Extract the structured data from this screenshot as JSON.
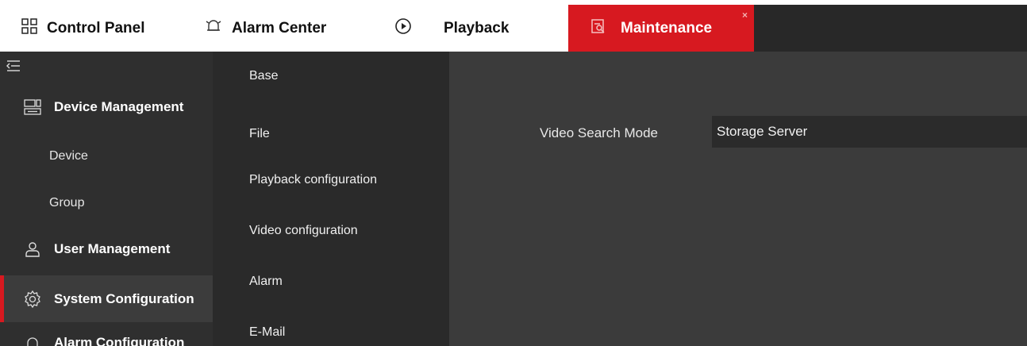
{
  "tabs": [
    {
      "label": "Control Panel",
      "icon": "grid-icon"
    },
    {
      "label": "Alarm Center",
      "icon": "bell-icon"
    },
    {
      "label": "Playback",
      "icon": "play-icon"
    },
    {
      "label": "Maintenance",
      "icon": "maintenance-icon",
      "active": true,
      "close": "×"
    }
  ],
  "sidebar": {
    "collapse_icon": "collapse-icon",
    "items": [
      {
        "label": "Device Management",
        "type": "group",
        "icon": "device-icon"
      },
      {
        "label": "Device",
        "type": "sub"
      },
      {
        "label": "Group",
        "type": "sub"
      },
      {
        "label": "User Management",
        "type": "group",
        "icon": "user-icon"
      },
      {
        "label": "System Configuration",
        "type": "group",
        "icon": "gear-icon",
        "active": true
      },
      {
        "label": "Alarm Configuration",
        "type": "group",
        "icon": "alarm-icon"
      }
    ]
  },
  "subnav": [
    "Base",
    "File",
    "Playback configuration",
    "Video configuration",
    "Alarm",
    "E-Mail"
  ],
  "main": {
    "field_label": "Video Search Mode",
    "field_value": "Storage Server"
  },
  "colors": {
    "accent": "#d71920",
    "topbar": "#282828",
    "sidebar": "#2f2f2f",
    "content": "#3b3b3b"
  }
}
